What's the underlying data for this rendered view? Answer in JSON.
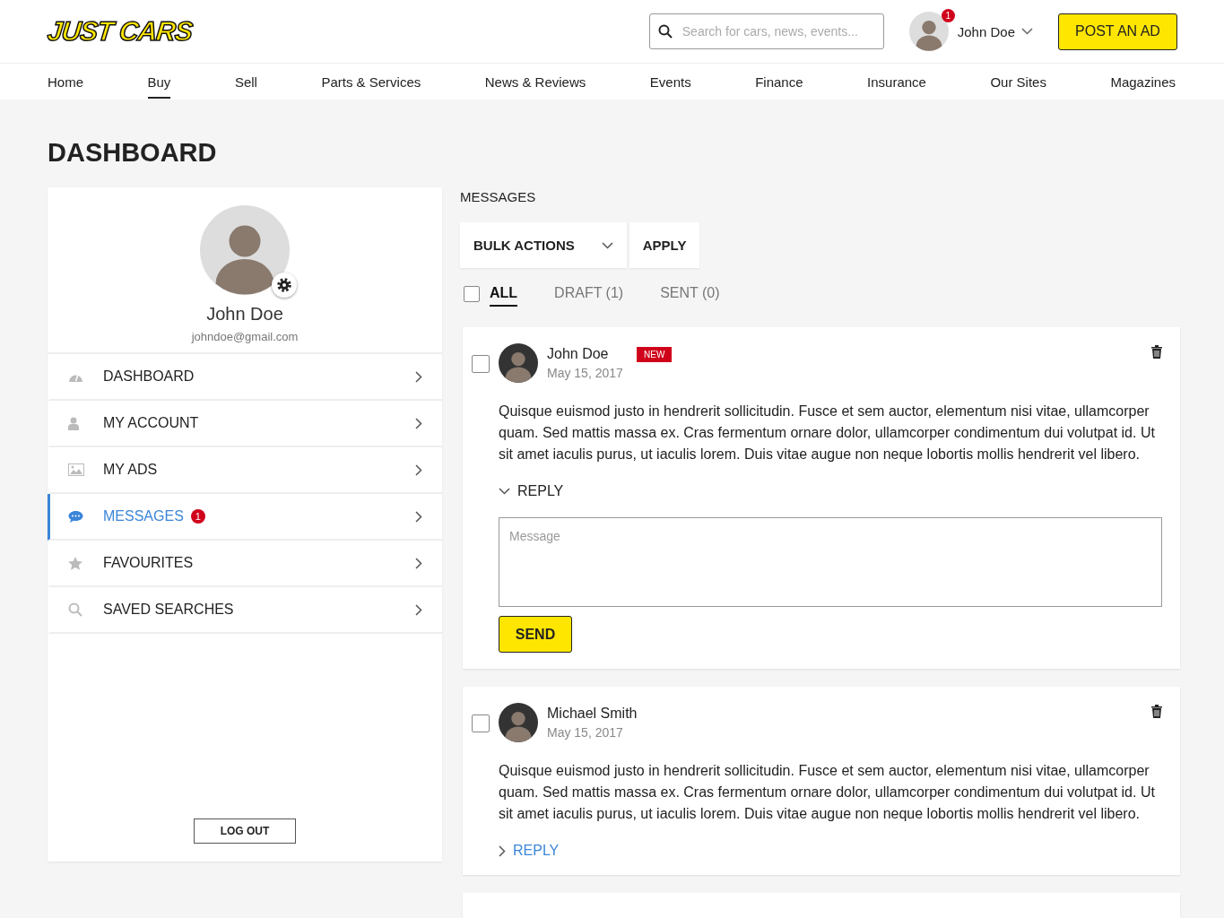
{
  "header": {
    "logo": "JUST CARS",
    "search": {
      "placeholder": "Search for cars, news, events..."
    },
    "user": {
      "name": "John Doe",
      "notifications": "1"
    },
    "post_button": "POST AN AD"
  },
  "nav": [
    {
      "label": "Home",
      "selected": false
    },
    {
      "label": "Buy",
      "selected": true
    },
    {
      "label": "Sell",
      "selected": false
    },
    {
      "label": "Parts & Services",
      "selected": false
    },
    {
      "label": "News & Reviews",
      "selected": false
    },
    {
      "label": "Events",
      "selected": false
    },
    {
      "label": "Finance",
      "selected": false
    },
    {
      "label": "Insurance",
      "selected": false
    },
    {
      "label": "Our Sites",
      "selected": false
    },
    {
      "label": "Magazines",
      "selected": false
    }
  ],
  "page_title": "DASHBOARD",
  "profile": {
    "name": "John Doe",
    "email": "johndoe@gmail.com"
  },
  "sidebar": {
    "items": [
      {
        "label": "DASHBOARD",
        "selected": false
      },
      {
        "label": "MY ACCOUNT",
        "selected": false
      },
      {
        "label": "MY ADS",
        "selected": false
      },
      {
        "label": "MESSAGES",
        "selected": true,
        "badge": "1"
      },
      {
        "label": "FAVOURITES",
        "selected": false
      },
      {
        "label": "SAVED SEARCHES",
        "selected": false
      }
    ],
    "logout": "LOG OUT"
  },
  "messages": {
    "title": "MESSAGES",
    "bulk_actions": "BULK ACTIONS",
    "apply": "APPLY",
    "select_all_checked": false,
    "filters": [
      {
        "label": "ALL",
        "selected": true
      },
      {
        "label": "DRAFT (1)",
        "selected": false
      },
      {
        "label": "SENT (0)",
        "selected": false
      }
    ],
    "items": [
      {
        "checked": false,
        "sender": "John Doe",
        "badge": "NEW",
        "date": "May 15, 2017",
        "body": "Quisque euismod justo in hendrerit sollicitudin. Fusce et sem auctor, elementum nisi vitae, ullamcorper quam. Sed mattis massa ex. Cras fermentum ornare dolor, ullamcorper condimentum dui volutpat id. Ut sit amet iaculis purus, ut iaculis lorem. Duis vitae augue non neque lobortis mollis hendrerit vel libero.",
        "reply_label": "REPLY",
        "expanded": true,
        "reply_placeholder": "Message",
        "send": "SEND"
      },
      {
        "checked": false,
        "sender": "Michael Smith",
        "date": "May 15, 2017",
        "body": "Quisque euismod justo in hendrerit sollicitudin. Fusce et sem auctor, elementum nisi vitae, ullamcorper quam. Sed mattis massa ex. Cras fermentum ornare dolor, ullamcorper condimentum dui volutpat id. Ut sit amet iaculis purus, ut iaculis lorem. Duis vitae augue non neque lobortis mollis hendrerit vel libero.",
        "reply_label": "REPLY",
        "expanded": false
      }
    ]
  }
}
